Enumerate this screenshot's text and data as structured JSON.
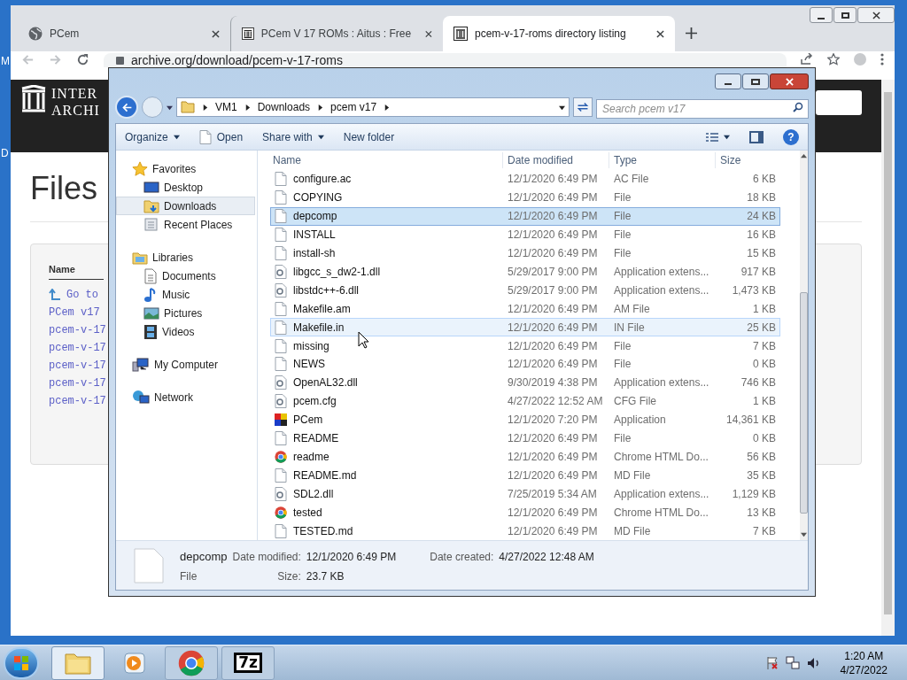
{
  "desktop": {
    "labels": [
      "M",
      "D"
    ]
  },
  "browser": {
    "tabs": [
      {
        "title": "PCem",
        "selected": false
      },
      {
        "title": "PCem V 17 ROMs : Aitus : Free",
        "selected": false
      },
      {
        "title": "pcem-v-17-roms directory listing",
        "selected": true
      }
    ],
    "url": "archive.org/download/pcem-v-17-roms",
    "logo": [
      "INTER",
      "ARCHI"
    ],
    "heading": "Files",
    "listing": {
      "column": "Name",
      "up_link": "Go to",
      "links": [
        "PCem v17",
        "pcem-v-17",
        "pcem-v-17",
        "pcem-v-17",
        "pcem-v-17",
        "pcem-v-17"
      ]
    }
  },
  "explorer": {
    "breadcrumb": [
      "VM1",
      "Downloads",
      "pcem v17"
    ],
    "search": {
      "placeholder": "Search pcem v17"
    },
    "help_label": "?",
    "toolbar": [
      {
        "label": "Organize",
        "kind": "menu"
      },
      {
        "label": "Open",
        "kind": "open"
      },
      {
        "label": "Share with",
        "kind": "menu"
      },
      {
        "label": "New folder",
        "kind": "plain"
      }
    ],
    "nav": [
      {
        "label": "Favorites",
        "kind": "star",
        "selected": false,
        "children": [
          {
            "label": "Desktop",
            "kind": "desktop",
            "selected": false
          },
          {
            "label": "Downloads",
            "kind": "downloads",
            "selected": true
          },
          {
            "label": "Recent Places",
            "kind": "recent",
            "selected": false
          }
        ]
      },
      {
        "label": "Libraries",
        "kind": "libraries",
        "selected": false,
        "children": [
          {
            "label": "Documents",
            "kind": "documents",
            "selected": false
          },
          {
            "label": "Music",
            "kind": "music",
            "selected": false
          },
          {
            "label": "Pictures",
            "kind": "pictures",
            "selected": false
          },
          {
            "label": "Videos",
            "kind": "videos",
            "selected": false
          }
        ]
      },
      {
        "label": "My Computer",
        "kind": "computer",
        "selected": false
      },
      {
        "label": "Network",
        "kind": "network",
        "selected": false
      }
    ],
    "columns": [
      "Name",
      "Date modified",
      "Type",
      "Size"
    ],
    "rows": [
      {
        "name": "configure.ac",
        "date": "12/1/2020 6:49 PM",
        "type": "AC File",
        "size": "6 KB",
        "kind": "file",
        "selected": false,
        "hovered": false
      },
      {
        "name": "COPYING",
        "date": "12/1/2020 6:49 PM",
        "type": "File",
        "size": "18 KB",
        "kind": "file",
        "selected": false,
        "hovered": false
      },
      {
        "name": "depcomp",
        "date": "12/1/2020 6:49 PM",
        "type": "File",
        "size": "24 KB",
        "kind": "file",
        "selected": true,
        "hovered": false
      },
      {
        "name": "INSTALL",
        "date": "12/1/2020 6:49 PM",
        "type": "File",
        "size": "16 KB",
        "kind": "file",
        "selected": false,
        "hovered": false
      },
      {
        "name": "install-sh",
        "date": "12/1/2020 6:49 PM",
        "type": "File",
        "size": "15 KB",
        "kind": "file",
        "selected": false,
        "hovered": false
      },
      {
        "name": "libgcc_s_dw2-1.dll",
        "date": "5/29/2017 9:00 PM",
        "type": "Application extens...",
        "size": "917 KB",
        "kind": "dll",
        "selected": false,
        "hovered": false
      },
      {
        "name": "libstdc++-6.dll",
        "date": "5/29/2017 9:00 PM",
        "type": "Application extens...",
        "size": "1,473 KB",
        "kind": "dll",
        "selected": false,
        "hovered": false
      },
      {
        "name": "Makefile.am",
        "date": "12/1/2020 6:49 PM",
        "type": "AM File",
        "size": "1 KB",
        "kind": "file",
        "selected": false,
        "hovered": false
      },
      {
        "name": "Makefile.in",
        "date": "12/1/2020 6:49 PM",
        "type": "IN File",
        "size": "25 KB",
        "kind": "file",
        "selected": false,
        "hovered": true
      },
      {
        "name": "missing",
        "date": "12/1/2020 6:49 PM",
        "type": "File",
        "size": "7 KB",
        "kind": "file",
        "selected": false,
        "hovered": false
      },
      {
        "name": "NEWS",
        "date": "12/1/2020 6:49 PM",
        "type": "File",
        "size": "0 KB",
        "kind": "file",
        "selected": false,
        "hovered": false
      },
      {
        "name": "OpenAL32.dll",
        "date": "9/30/2019 4:38 PM",
        "type": "Application extens...",
        "size": "746 KB",
        "kind": "dll",
        "selected": false,
        "hovered": false
      },
      {
        "name": "pcem.cfg",
        "date": "4/27/2022 12:52 AM",
        "type": "CFG File",
        "size": "1 KB",
        "kind": "dll",
        "selected": false,
        "hovered": false
      },
      {
        "name": "PCem",
        "date": "12/1/2020 7:20 PM",
        "type": "Application",
        "size": "14,361 KB",
        "kind": "app",
        "selected": false,
        "hovered": false
      },
      {
        "name": "README",
        "date": "12/1/2020 6:49 PM",
        "type": "File",
        "size": "0 KB",
        "kind": "file",
        "selected": false,
        "hovered": false
      },
      {
        "name": "readme",
        "date": "12/1/2020 6:49 PM",
        "type": "Chrome HTML Do...",
        "size": "56 KB",
        "kind": "chrome",
        "selected": false,
        "hovered": false
      },
      {
        "name": "README.md",
        "date": "12/1/2020 6:49 PM",
        "type": "MD File",
        "size": "35 KB",
        "kind": "file",
        "selected": false,
        "hovered": false
      },
      {
        "name": "SDL2.dll",
        "date": "7/25/2019 5:34 AM",
        "type": "Application extens...",
        "size": "1,129 KB",
        "kind": "dll",
        "selected": false,
        "hovered": false
      },
      {
        "name": "tested",
        "date": "12/1/2020 6:49 PM",
        "type": "Chrome HTML Do...",
        "size": "13 KB",
        "kind": "chrome",
        "selected": false,
        "hovered": false
      },
      {
        "name": "TESTED.md",
        "date": "12/1/2020 6:49 PM",
        "type": "MD File",
        "size": "7 KB",
        "kind": "file",
        "selected": false,
        "hovered": false
      }
    ],
    "details": {
      "name": "depcomp",
      "type": "File",
      "modified_label": "Date modified:",
      "modified": "12/1/2020 6:49 PM",
      "size_label": "Size:",
      "size": "23.7 KB",
      "created_label": "Date created:",
      "created": "4/27/2022 12:48 AM"
    }
  },
  "taskbar": {
    "items": [
      {
        "kind": "folder",
        "running": true,
        "active": true
      },
      {
        "kind": "media",
        "running": false,
        "active": false
      },
      {
        "kind": "chrome",
        "running": true,
        "active": false
      },
      {
        "kind": "archiver",
        "label": "7z",
        "running": true,
        "active": false
      }
    ],
    "time": "1:20 AM",
    "date": "4/27/2022"
  }
}
